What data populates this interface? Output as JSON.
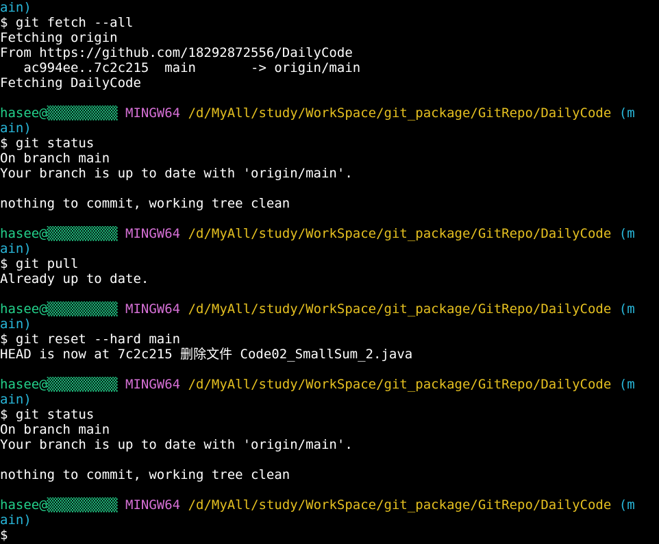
{
  "colors": {
    "background": "#000000",
    "text": "#ffffff",
    "user_host": "#23d18b",
    "mingw": "#d670d6",
    "path": "#e5c020",
    "branch": "#29b8db"
  },
  "prompt": {
    "user_host": "hasee@▒▒▒▒▒▒▒▒▒",
    "shell": "MINGW64",
    "path": "/d/MyAll/study/WorkSpace/git_package/GitRepo/DailyCode",
    "branch_open": "(m",
    "branch_close": "ain)"
  },
  "lines": [
    {
      "type": "branch_tail",
      "text": "ain)"
    },
    {
      "type": "text",
      "text": "$ git fetch --all"
    },
    {
      "type": "text",
      "text": "Fetching origin"
    },
    {
      "type": "text",
      "text": "From https://github.com/18292872556/DailyCode"
    },
    {
      "type": "text",
      "text": "   ac994ee..7c2c215  main       -> origin/main"
    },
    {
      "type": "text",
      "text": "Fetching DailyCode"
    },
    {
      "type": "text",
      "text": ""
    },
    {
      "type": "prompt"
    },
    {
      "type": "branch_tail",
      "text": "ain)"
    },
    {
      "type": "text",
      "text": "$ git status"
    },
    {
      "type": "text",
      "text": "On branch main"
    },
    {
      "type": "text",
      "text": "Your branch is up to date with 'origin/main'."
    },
    {
      "type": "text",
      "text": ""
    },
    {
      "type": "text",
      "text": "nothing to commit, working tree clean"
    },
    {
      "type": "text",
      "text": ""
    },
    {
      "type": "prompt"
    },
    {
      "type": "branch_tail",
      "text": "ain)"
    },
    {
      "type": "text",
      "text": "$ git pull"
    },
    {
      "type": "text",
      "text": "Already up to date."
    },
    {
      "type": "text",
      "text": ""
    },
    {
      "type": "prompt"
    },
    {
      "type": "branch_tail",
      "text": "ain)"
    },
    {
      "type": "text",
      "text": "$ git reset --hard main"
    },
    {
      "type": "text",
      "text": "HEAD is now at 7c2c215 删除文件 Code02_SmallSum_2.java"
    },
    {
      "type": "text",
      "text": ""
    },
    {
      "type": "prompt"
    },
    {
      "type": "branch_tail",
      "text": "ain)"
    },
    {
      "type": "text",
      "text": "$ git status"
    },
    {
      "type": "text",
      "text": "On branch main"
    },
    {
      "type": "text",
      "text": "Your branch is up to date with 'origin/main'."
    },
    {
      "type": "text",
      "text": ""
    },
    {
      "type": "text",
      "text": "nothing to commit, working tree clean"
    },
    {
      "type": "text",
      "text": ""
    },
    {
      "type": "prompt"
    },
    {
      "type": "branch_tail",
      "text": "ain)"
    },
    {
      "type": "input",
      "text": "$"
    }
  ]
}
